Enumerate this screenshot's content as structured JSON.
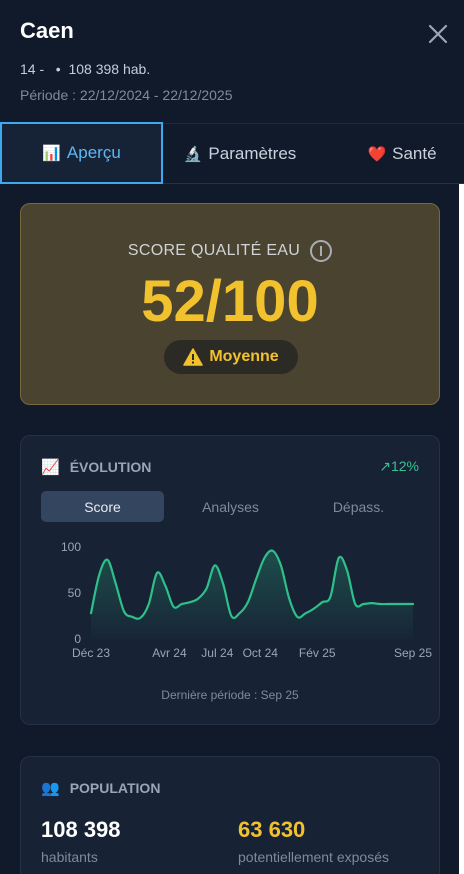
{
  "header": {
    "city": "Caen",
    "department": "14 -",
    "separator": "•",
    "population_text": "108 398 hab.",
    "period": "Période : 22/12/2024 - 22/12/2025",
    "close_icon": "close-icon"
  },
  "tabs": [
    {
      "icon": "📊",
      "label": "Aperçu",
      "active": true
    },
    {
      "icon": "🔬",
      "label": "Paramètres",
      "active": false
    },
    {
      "icon": "❤️",
      "label": "Santé",
      "active": false
    }
  ],
  "score": {
    "title": "SCORE QUALITÉ EAU",
    "value": "52/100",
    "badge_icon": "⚠️",
    "badge_label": "Moyenne",
    "colors": {
      "accent": "#f2c12e",
      "card": "#4a4330"
    }
  },
  "evolution": {
    "icon": "📈",
    "title": "ÉVOLUTION",
    "trend": "↗12%",
    "segments": [
      "Score",
      "Analyses",
      "Dépass."
    ],
    "active_segment": "Score",
    "last_period": "Dernière période : Sep 25"
  },
  "chart_data": {
    "type": "area",
    "title": "",
    "xlabel": "",
    "ylabel": "",
    "ylim": [
      0,
      100
    ],
    "yticks": [
      "100",
      "50",
      "0"
    ],
    "xtick_labels": [
      "Déc 23",
      "Avr 24",
      "Jul 24",
      "Oct 24",
      "Fév 25",
      "Sep 25"
    ],
    "series": [
      {
        "color": "#2ec08a",
        "x": [
          0,
          1,
          2,
          3,
          4,
          5,
          6,
          7,
          8,
          9,
          10,
          11,
          12,
          13,
          14,
          15,
          16,
          17,
          18,
          19,
          20,
          21,
          22,
          23,
          24,
          25,
          26,
          27,
          28,
          29,
          30,
          31,
          32,
          33,
          34,
          35,
          36,
          37,
          38,
          39
        ],
        "values": [
          28,
          70,
          86,
          60,
          30,
          24,
          23,
          38,
          72,
          58,
          35,
          38,
          40,
          44,
          55,
          80,
          60,
          25,
          28,
          40,
          65,
          88,
          96,
          80,
          44,
          24,
          28,
          33,
          40,
          46,
          88,
          75,
          38,
          38,
          39,
          38,
          38,
          38,
          38,
          38
        ]
      }
    ]
  },
  "population": {
    "icon": "👥",
    "title": "POPULATION",
    "inhabitants": "108 398",
    "inhabitants_label": "habitants",
    "exposed": "63 630",
    "exposed_label": "potentiellement exposés"
  }
}
